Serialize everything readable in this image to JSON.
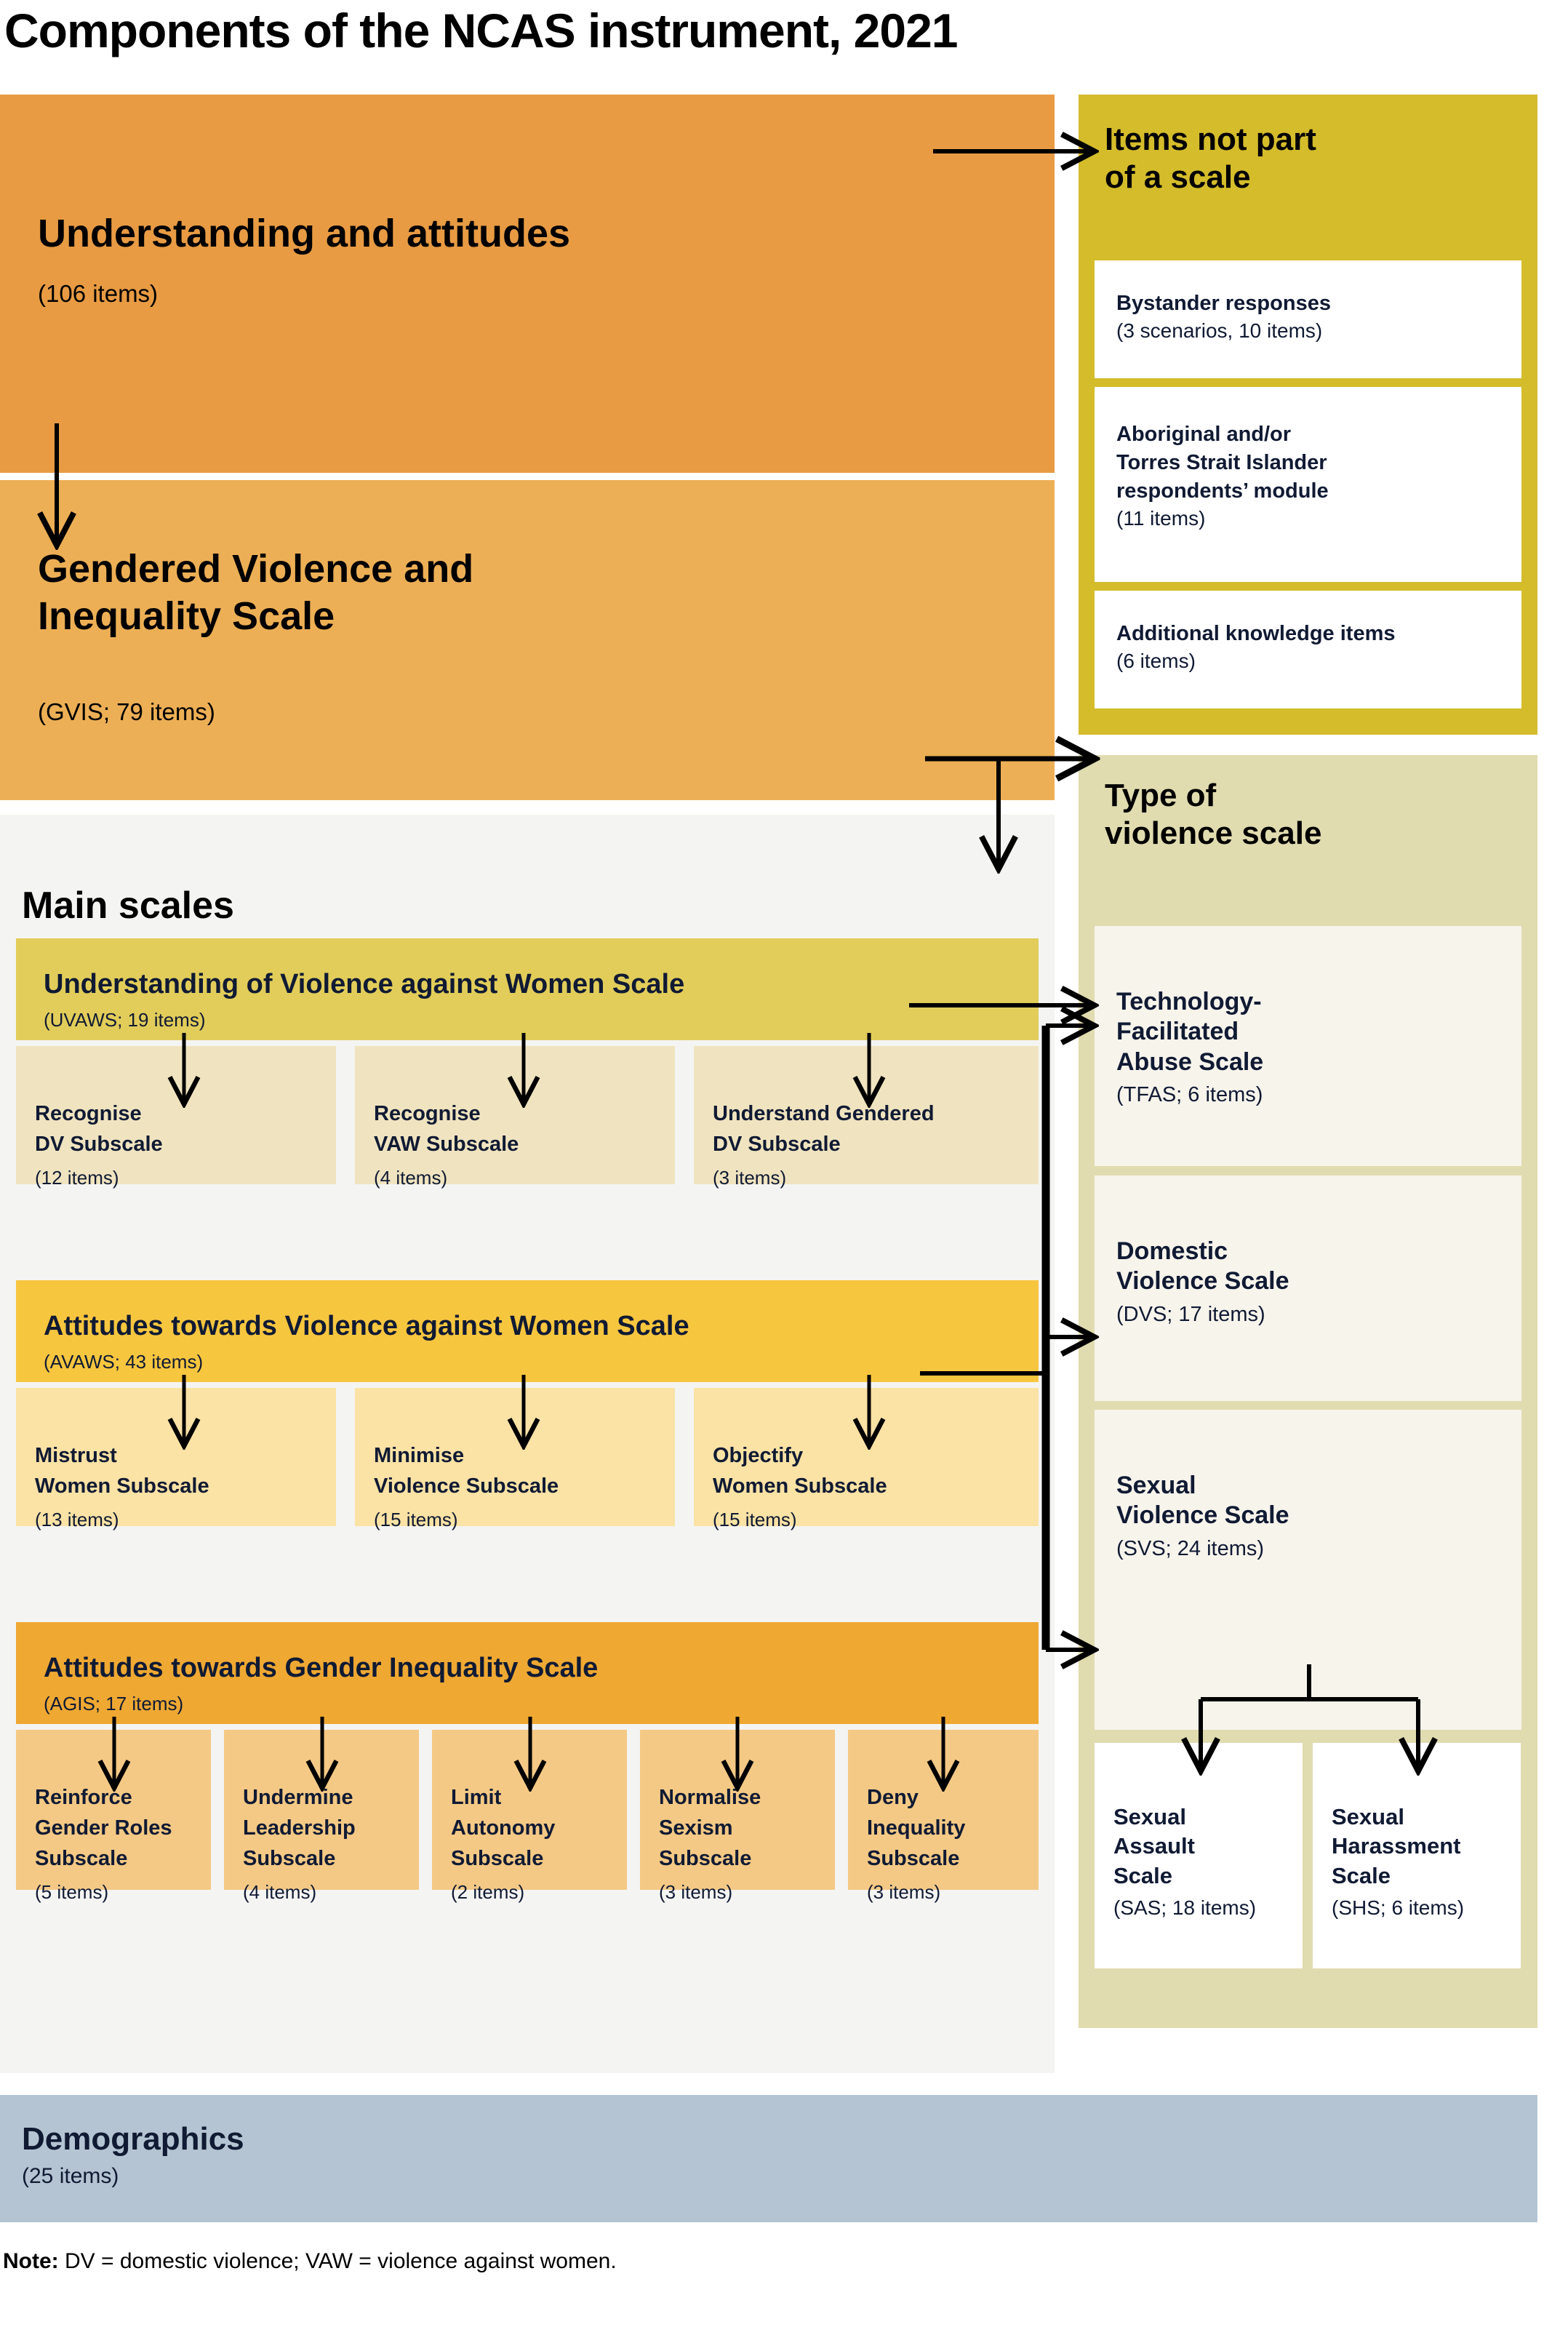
{
  "title": "Components of the NCAS instrument, 2021",
  "note": {
    "label": "Note:",
    "text": " DV = domestic violence; VAW = violence against women."
  },
  "colors": {
    "understanding": "#e89b43",
    "gvis": "#edaf55",
    "main_panel": "#f4f4f2",
    "uvaws": "#e2cd5a",
    "uvaws_sub": "#f0e4c0",
    "avaws": "#f7c63f",
    "avaws_sub": "#fbe2a5",
    "agis": "#efa832",
    "agis_sub": "#f4c985",
    "items_not_scale": "#d4bc2b",
    "type_of_violence": "#e1dcb0",
    "type_card": "#f7f4ec",
    "demographics": "#b4c4d2",
    "text_dark": "#101a33"
  },
  "understanding": {
    "title": "Understanding and attitudes",
    "sub": "(106 items)"
  },
  "gvis": {
    "title_line1": "Gendered Violence and",
    "title_line2": "Inequality Scale",
    "sub": "(GVIS; 79 items)"
  },
  "main_scales": {
    "heading": "Main scales",
    "groups": [
      {
        "title": "Understanding of Violence against Women Scale",
        "sub": "(UVAWS; 19 items)",
        "subscales": [
          {
            "line1": "Recognise",
            "line2": "DV Subscale",
            "sub": "(12 items)"
          },
          {
            "line1": "Recognise",
            "line2": "VAW Subscale",
            "sub": "(4 items)"
          },
          {
            "line1": "Understand Gendered",
            "line2": "DV Subscale",
            "sub": "(3 items)"
          }
        ]
      },
      {
        "title": "Attitudes towards Violence against Women Scale",
        "sub": "(AVAWS; 43 items)",
        "subscales": [
          {
            "line1": "Mistrust",
            "line2": "Women Subscale",
            "sub": "(13 items)"
          },
          {
            "line1": "Minimise",
            "line2": "Violence Subscale",
            "sub": "(15 items)"
          },
          {
            "line1": "Objectify",
            "line2": "Women Subscale",
            "sub": "(15 items)"
          }
        ]
      },
      {
        "title": "Attitudes towards Gender Inequality Scale",
        "sub": "(AGIS; 17 items)",
        "subscales": [
          {
            "line1": "Reinforce",
            "line2": "Gender Roles",
            "line3": "Subscale",
            "sub": "(5 items)"
          },
          {
            "line1": "Undermine",
            "line2": "Leadership",
            "line3": "Subscale",
            "sub": "(4 items)"
          },
          {
            "line1": "Limit",
            "line2": "Autonomy",
            "line3": "Subscale",
            "sub": "(2 items)"
          },
          {
            "line1": "Normalise",
            "line2": "Sexism",
            "line3": "Subscale",
            "sub": "(3 items)"
          },
          {
            "line1": "Deny",
            "line2": "Inequality",
            "line3": "Subscale",
            "sub": "(3 items)"
          }
        ]
      }
    ]
  },
  "items_not_part_of_scale": {
    "title_line1": "Items not part",
    "title_line2": "of a scale",
    "cards": [
      {
        "title": "Bystander responses",
        "sub": "(3 scenarios, 10 items)"
      },
      {
        "title_line1": "Aboriginal and/or",
        "title_line2": "Torres Strait Islander",
        "title_line3": "respondents’ module",
        "sub": "(11 items)"
      },
      {
        "title": "Additional knowledge items",
        "sub": "(6 items)"
      }
    ]
  },
  "type_of_violence_scale": {
    "title_line1": "Type of",
    "title_line2": "violence scale",
    "cards": [
      {
        "line1": "Technology-",
        "line2": "Facilitated",
        "line3": "Abuse Scale",
        "sub": "(TFAS; 6 items)"
      },
      {
        "line1": "Domestic",
        "line2": "Violence Scale",
        "sub": "(DVS; 17 items)"
      },
      {
        "line1": "Sexual",
        "line2": "Violence Scale",
        "sub": "(SVS; 24 items)"
      }
    ],
    "sub_cards": [
      {
        "line1": "Sexual",
        "line2": "Assault",
        "line3": "Scale",
        "sub": "(SAS; 18 items)"
      },
      {
        "line1": "Sexual",
        "line2": "Harassment",
        "line3": "Scale",
        "sub": "(SHS; 6 items)"
      }
    ]
  },
  "demographics": {
    "title": "Demographics",
    "sub": "(25 items)"
  }
}
